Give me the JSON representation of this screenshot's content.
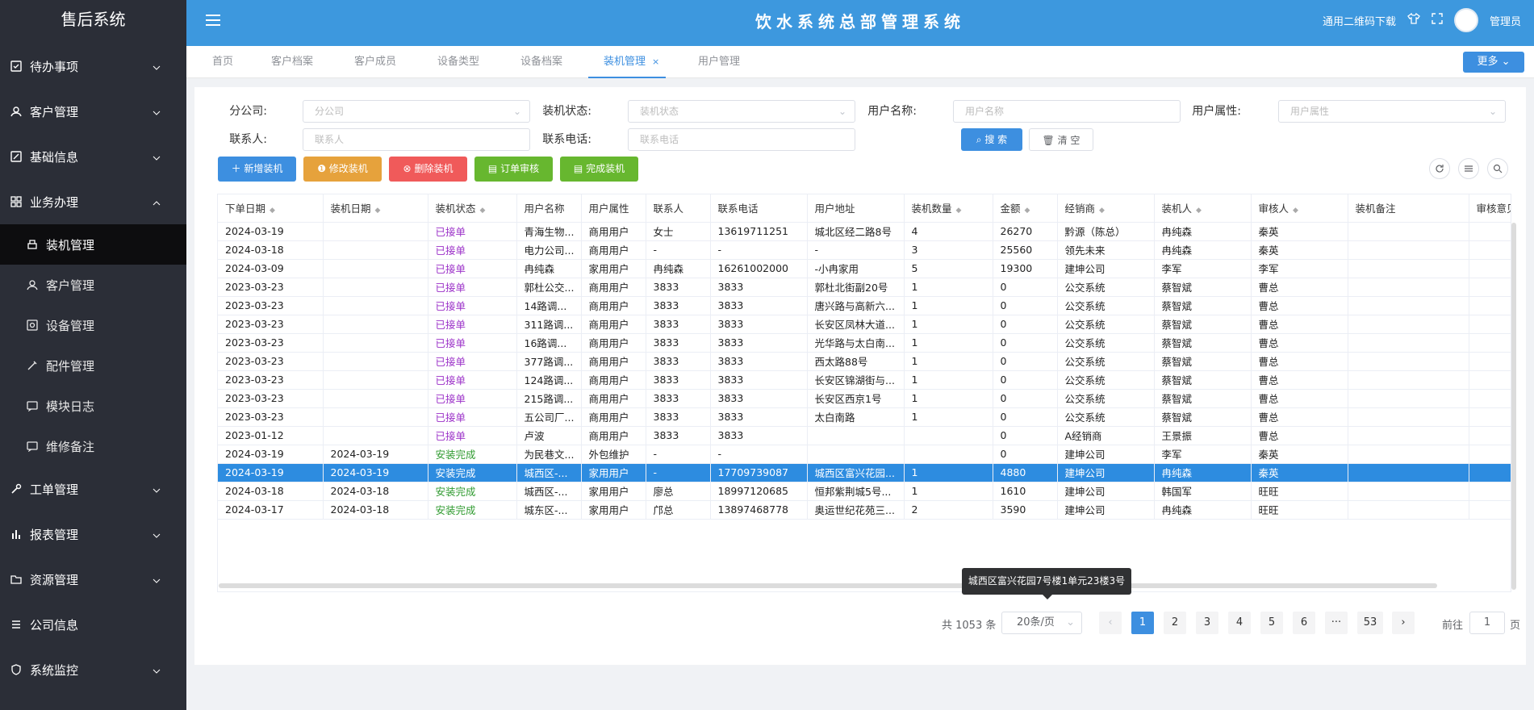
{
  "sidebar": {
    "brand": "售后系统",
    "items": [
      {
        "label": "待办事项",
        "icon": "todo-icon"
      },
      {
        "label": "客户管理",
        "icon": "user-icon"
      },
      {
        "label": "基础信息",
        "icon": "edit-icon"
      },
      {
        "label": "业务办理",
        "icon": "grid-icon"
      },
      {
        "label": "工单管理",
        "icon": "wrench-icon"
      },
      {
        "label": "报表管理",
        "icon": "bar-chart-icon"
      },
      {
        "label": "资源管理",
        "icon": "folder-icon"
      },
      {
        "label": "公司信息",
        "icon": "list-icon"
      },
      {
        "label": "系统监控",
        "icon": "shield-icon"
      }
    ],
    "subitems": [
      {
        "label": "装机管理",
        "icon": "printer-icon"
      },
      {
        "label": "客户管理",
        "icon": "user-icon"
      },
      {
        "label": "设备管理",
        "icon": "device-icon"
      },
      {
        "label": "配件管理",
        "icon": "part-icon"
      },
      {
        "label": "模块日志",
        "icon": "message-icon"
      },
      {
        "label": "维修备注",
        "icon": "message-icon"
      }
    ]
  },
  "header": {
    "title": "饮水系统总部管理系统",
    "qr_download": "通用二维码下载",
    "user": "管理员"
  },
  "tabs": [
    "首页",
    "客户档案",
    "客户成员",
    "设备类型",
    "设备档案",
    "装机管理",
    "用户管理"
  ],
  "more_label": "更多",
  "filters": {
    "branch": {
      "label": "分公司:",
      "placeholder": "分公司"
    },
    "install_status": {
      "label": "装机状态:",
      "placeholder": "装机状态"
    },
    "user_name": {
      "label": "用户名称:",
      "placeholder": "用户名称"
    },
    "user_attr": {
      "label": "用户属性:",
      "placeholder": "用户属性"
    },
    "contact": {
      "label": "联系人:",
      "placeholder": "联系人"
    },
    "phone": {
      "label": "联系电话:",
      "placeholder": "联系电话"
    },
    "search": "搜 索",
    "clear": "清 空"
  },
  "actions": {
    "add": "新增装机",
    "edit": "修改装机",
    "delete": "删除装机",
    "audit": "订单审核",
    "complete": "完成装机"
  },
  "colors": {
    "accepted": "#9b30c8",
    "done": "#2e9a2e",
    "selected": "#2d8ce0"
  },
  "table": {
    "columns": [
      "下单日期",
      "装机日期",
      "装机状态",
      "用户名称",
      "用户属性",
      "联系人",
      "联系电话",
      "用户地址",
      "装机数量",
      "金额",
      "经销商",
      "装机人",
      "审核人",
      "装机备注",
      "审核意见"
    ],
    "rows": [
      [
        "2024-03-19",
        "",
        "已接单",
        "青海生物...",
        "商用用户",
        "女士",
        "13619711251",
        "城北区经二路8号",
        "4",
        "26270",
        "黔源（陈总）",
        "冉纯森",
        "秦英",
        "",
        ""
      ],
      [
        "2024-03-18",
        "",
        "已接单",
        "电力公司...",
        "商用用户",
        "-",
        "-",
        "-",
        "3",
        "25560",
        "领先未来",
        "冉纯森",
        "秦英",
        "",
        ""
      ],
      [
        "2024-03-09",
        "",
        "已接单",
        "冉纯森",
        "家用用户",
        "冉纯森",
        "16261002000",
        "-小冉家用",
        "5",
        "19300",
        "建坤公司",
        "李军",
        "李军",
        "",
        ""
      ],
      [
        "2023-03-23",
        "",
        "已接单",
        "郭杜公交...",
        "商用用户",
        "3833",
        "3833",
        "郭杜北街副20号",
        "1",
        "0",
        "公交系统",
        "蔡智斌",
        "曹总",
        "",
        ""
      ],
      [
        "2023-03-23",
        "",
        "已接单",
        "14路调...",
        "商用用户",
        "3833",
        "3833",
        "唐兴路与高新六...",
        "1",
        "0",
        "公交系统",
        "蔡智斌",
        "曹总",
        "",
        ""
      ],
      [
        "2023-03-23",
        "",
        "已接单",
        "311路调...",
        "商用用户",
        "3833",
        "3833",
        "长安区凤林大道...",
        "1",
        "0",
        "公交系统",
        "蔡智斌",
        "曹总",
        "",
        ""
      ],
      [
        "2023-03-23",
        "",
        "已接单",
        "16路调...",
        "商用用户",
        "3833",
        "3833",
        "光华路与太白南...",
        "1",
        "0",
        "公交系统",
        "蔡智斌",
        "曹总",
        "",
        ""
      ],
      [
        "2023-03-23",
        "",
        "已接单",
        "377路调...",
        "商用用户",
        "3833",
        "3833",
        "西太路88号",
        "1",
        "0",
        "公交系统",
        "蔡智斌",
        "曹总",
        "",
        ""
      ],
      [
        "2023-03-23",
        "",
        "已接单",
        "124路调...",
        "商用用户",
        "3833",
        "3833",
        "长安区锦湖街与...",
        "1",
        "0",
        "公交系统",
        "蔡智斌",
        "曹总",
        "",
        ""
      ],
      [
        "2023-03-23",
        "",
        "已接单",
        "215路调...",
        "商用用户",
        "3833",
        "3833",
        "长安区西京1号",
        "1",
        "0",
        "公交系统",
        "蔡智斌",
        "曹总",
        "",
        ""
      ],
      [
        "2023-03-23",
        "",
        "已接单",
        "五公司厂...",
        "商用用户",
        "3833",
        "3833",
        "太白南路",
        "1",
        "0",
        "公交系统",
        "蔡智斌",
        "曹总",
        "",
        ""
      ],
      [
        "2023-01-12",
        "",
        "已接单",
        "卢波",
        "商用用户",
        "3833",
        "3833",
        "",
        "",
        "0",
        "A经销商",
        "王景振",
        "曹总",
        "",
        ""
      ],
      [
        "2024-03-19",
        "2024-03-19",
        "安装完成",
        "为民巷文...",
        "外包维护",
        "-",
        "-",
        "",
        "",
        "0",
        "建坤公司",
        "李军",
        "秦英",
        "",
        ""
      ],
      [
        "2024-03-19",
        "2024-03-19",
        "安装完成",
        "城西区-...",
        "家用用户",
        "-",
        "17709739087",
        "城西区富兴花园...",
        "1",
        "4880",
        "建坤公司",
        "冉纯森",
        "秦英",
        "",
        ""
      ],
      [
        "2024-03-18",
        "2024-03-18",
        "安装完成",
        "城西区-...",
        "家用用户",
        "廖总",
        "18997120685",
        "恒邦紫荆城5号...",
        "1",
        "1610",
        "建坤公司",
        "韩国军",
        "旺旺",
        "",
        ""
      ],
      [
        "2024-03-17",
        "2024-03-18",
        "安装完成",
        "城东区-...",
        "家用用户",
        "邝总",
        "13897468778",
        "奥运世纪花苑三...",
        "2",
        "3590",
        "建坤公司",
        "冉纯森",
        "旺旺",
        "",
        ""
      ]
    ]
  },
  "tooltip": "城西区富兴花园7号楼1单元23楼3号",
  "pagination": {
    "total": "共 1053 条",
    "page_size": "20条/页",
    "pages": [
      "1",
      "2",
      "3",
      "4",
      "5",
      "6",
      "···",
      "53"
    ],
    "goto_label": "前往",
    "goto_value": "1",
    "page_unit": "页"
  }
}
